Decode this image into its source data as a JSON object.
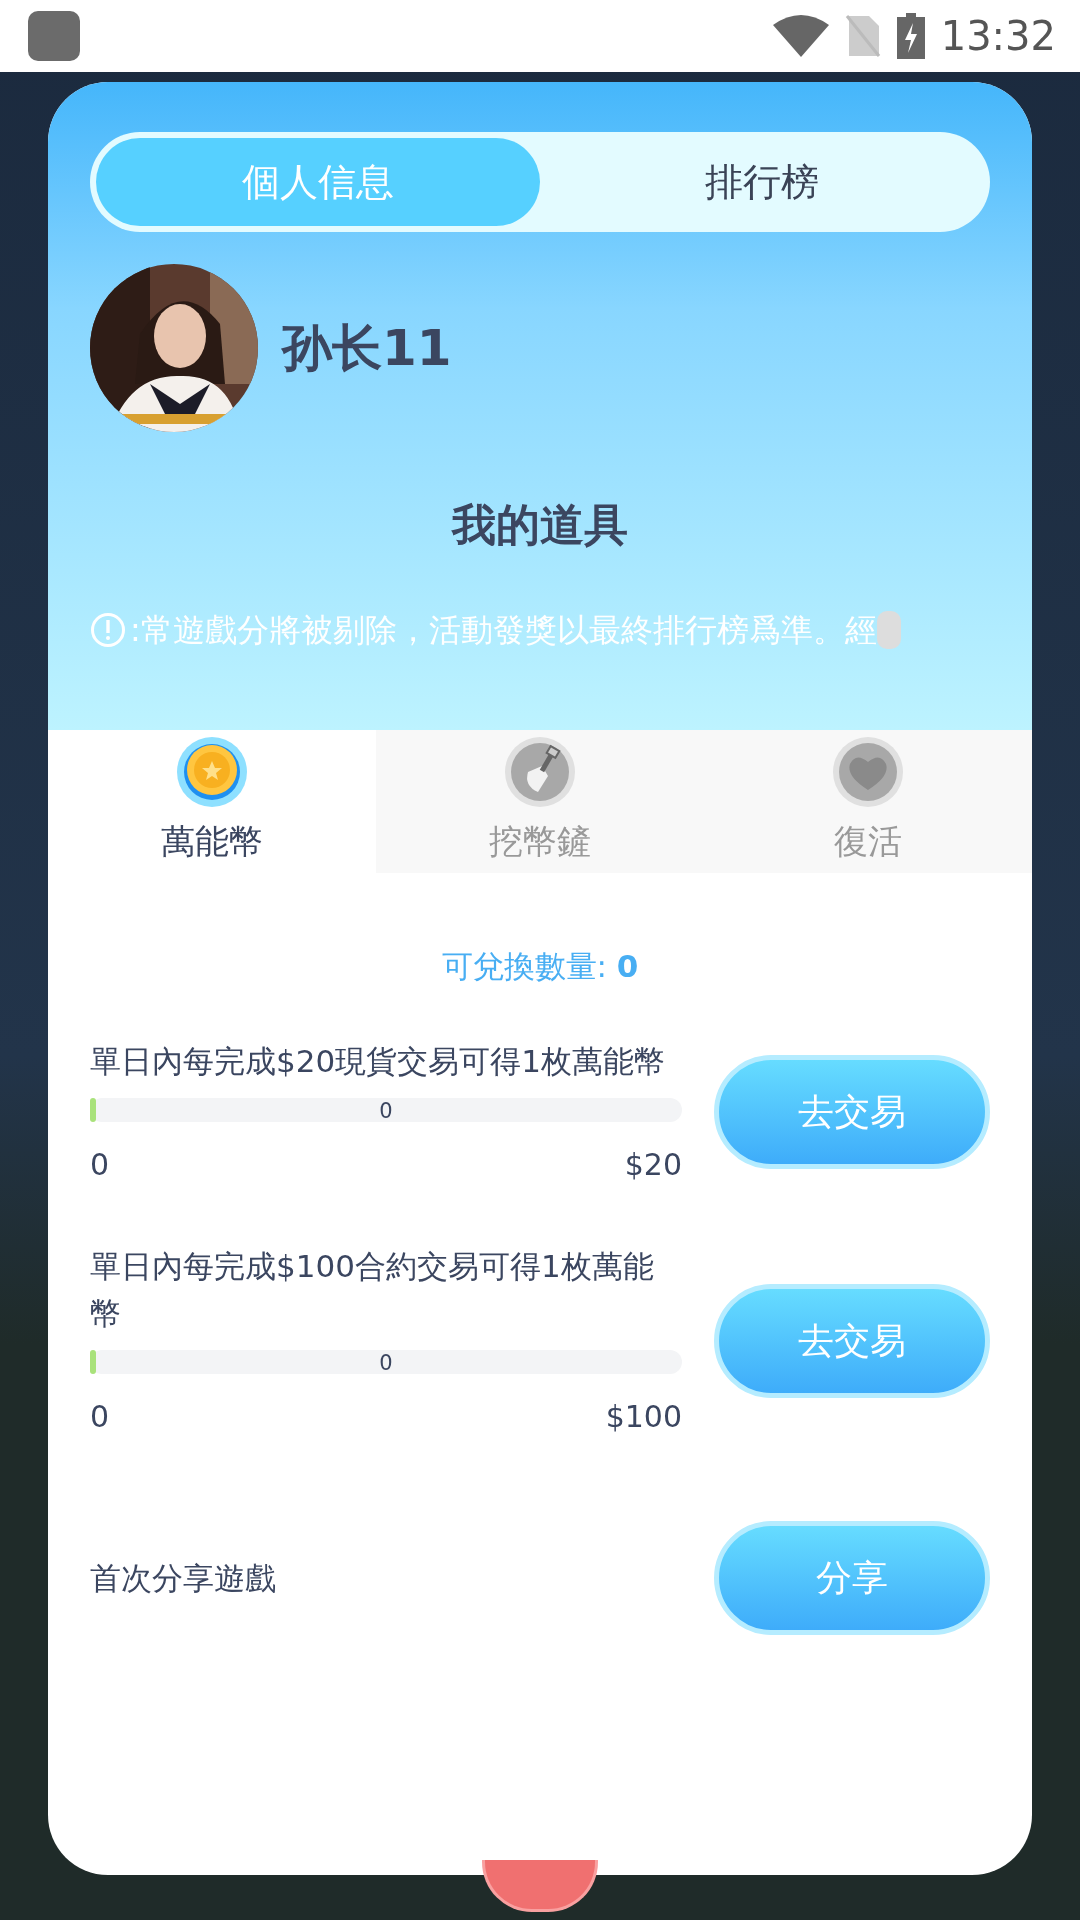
{
  "status_bar": {
    "time": "13:32"
  },
  "tabs": [
    {
      "label": "個人信息",
      "selected": true
    },
    {
      "label": "排行榜",
      "selected": false
    }
  ],
  "profile": {
    "name": "孙长11"
  },
  "section_title": "我的道具",
  "notice": ":常遊戲分將被剔除，活動發獎以最終排行榜爲準。經",
  "item_tabs": [
    {
      "label": "萬能幣",
      "kind": "coin",
      "selected": true
    },
    {
      "label": "挖幣鏟",
      "kind": "shovel",
      "selected": false
    },
    {
      "label": "復活",
      "kind": "heart",
      "selected": false
    }
  ],
  "exchange": {
    "label": "可兌換數量:",
    "value": "0"
  },
  "tasks": [
    {
      "text": "單日內每完成$20現貨交易可得1枚萬能幣",
      "progress": {
        "level": 0.01,
        "reading": "0",
        "min": "0",
        "max": "$20"
      },
      "button": "去交易"
    },
    {
      "text": "單日內每完成$100合約交易可得1枚萬能幣",
      "progress": {
        "level": 0.01,
        "reading": "0",
        "min": "0",
        "max": "$100"
      },
      "button": "去交易"
    },
    {
      "text": "首次分享遊戲",
      "button": "分享"
    }
  ]
}
